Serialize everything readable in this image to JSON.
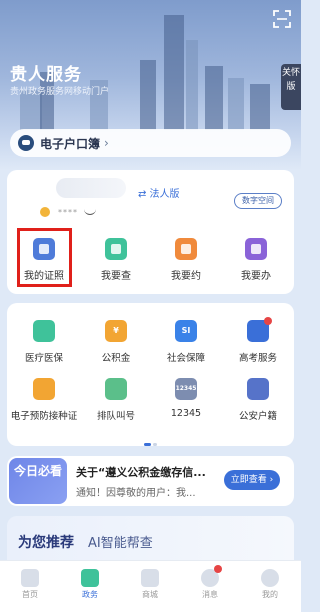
{
  "header": {
    "title": "贵人服务",
    "subtitle": "贵州政务服务网移动门户",
    "care_mode": "关怀版"
  },
  "household": {
    "label": "电子户口簿",
    "arrow": "›"
  },
  "account": {
    "masked_name": "****",
    "switch_label": "⇄ 法人版",
    "digital_space": "数字空间"
  },
  "quick_actions": [
    {
      "label": "我的证照",
      "color": "#4f7bd9"
    },
    {
      "label": "我要查",
      "color": "#3fc29a"
    },
    {
      "label": "我要约",
      "color": "#f08a3c"
    },
    {
      "label": "我要办",
      "color": "#8a63d8"
    }
  ],
  "services": [
    {
      "label": "医疗医保",
      "color": "#3fc29a",
      "icon": "medical-insurance-icon",
      "glyph": ""
    },
    {
      "label": "公积金",
      "color": "#f2a533",
      "icon": "housing-fund-icon",
      "glyph": "¥"
    },
    {
      "label": "社会保障",
      "color": "#3a82e8",
      "icon": "social-security-icon",
      "glyph": "SI"
    },
    {
      "label": "高考服务",
      "color": "#3a6fd8",
      "icon": "graduation-cap-icon",
      "glyph": ""
    },
    {
      "label": "电子预防接种证",
      "color": "#f2a533",
      "icon": "vaccination-icon",
      "glyph": ""
    },
    {
      "label": "排队叫号",
      "color": "#5bbf8a",
      "icon": "queue-icon",
      "glyph": ""
    },
    {
      "label": "12345",
      "color": "#7d8db0",
      "icon": "hotline-icon",
      "glyph": "12345"
    },
    {
      "label": "公安户籍",
      "color": "#5673c9",
      "icon": "police-icon",
      "glyph": ""
    }
  ],
  "notice": {
    "tag": "今日必看",
    "title": "关于“遵义公积金缴存信...",
    "body": "通知！因尊敬的用户：我...",
    "button": "立即查看 ›"
  },
  "recommend": {
    "title": "为您推荐",
    "ai_label": "AI智能帮查"
  },
  "tabbar": [
    {
      "label": "首页",
      "icon": "home-icon"
    },
    {
      "label": "政务",
      "icon": "government-icon"
    },
    {
      "label": "商城",
      "icon": "store-icon"
    },
    {
      "label": "消息",
      "icon": "message-icon"
    },
    {
      "label": "我的",
      "icon": "profile-icon"
    }
  ],
  "colors": {
    "accent": "#3a6fd8",
    "highlight_box": "#e0201a"
  }
}
